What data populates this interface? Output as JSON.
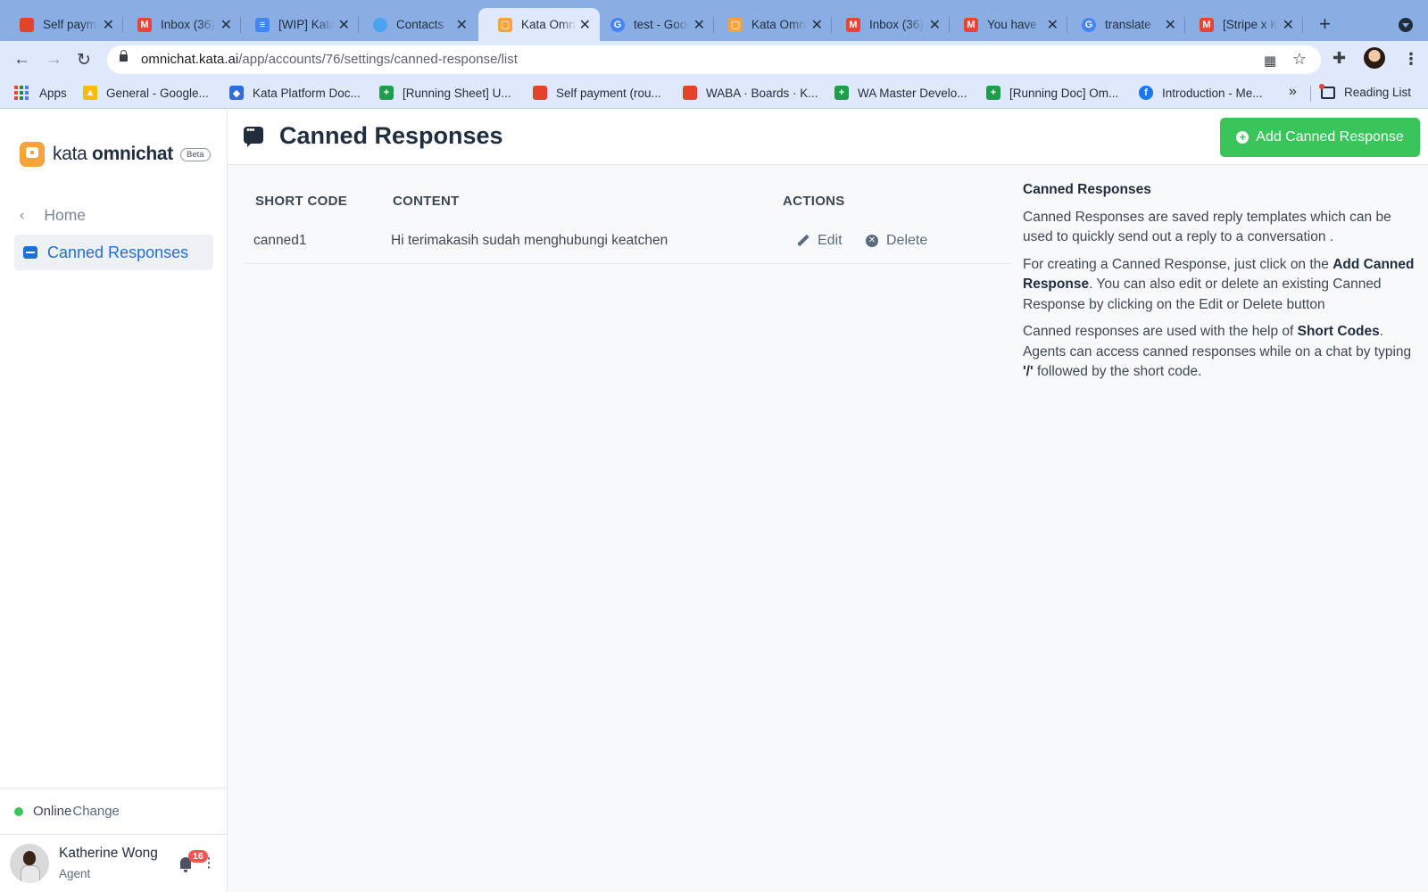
{
  "browser": {
    "tabs": [
      {
        "title": "Self payment",
        "icon": "gitlab-icon",
        "color": "#e24329"
      },
      {
        "title": "Inbox (36)",
        "icon": "gmail-icon",
        "color": "#ea4335"
      },
      {
        "title": "[WIP] Kata",
        "icon": "docs-icon",
        "color": "#4285f4"
      },
      {
        "title": "Contacts",
        "icon": "contacts-icon",
        "color": "#4aa3f0"
      },
      {
        "title": "Kata Omnichat",
        "icon": "kata-icon",
        "color": "#f7a33c"
      },
      {
        "title": "test - Google",
        "icon": "google-icon",
        "color": "#4285f4"
      },
      {
        "title": "Kata Omnichat",
        "icon": "kata-icon",
        "color": "#f7a33c"
      },
      {
        "title": "Inbox (36)",
        "icon": "gmail-icon",
        "color": "#ea4335"
      },
      {
        "title": "You have",
        "icon": "gmail-icon",
        "color": "#ea4335"
      },
      {
        "title": "translate",
        "icon": "google-icon",
        "color": "#4285f4"
      },
      {
        "title": "[Stripe x K",
        "icon": "gmail-icon",
        "color": "#ea4335"
      }
    ],
    "url_host": "omnichat.kata.ai",
    "url_path": "/app/accounts/76/settings/canned-response/list",
    "bookmarks": [
      {
        "label": "Apps"
      },
      {
        "label": "General - Google...",
        "icon": "drive-icon",
        "color": "#fbbc04"
      },
      {
        "label": "Kata Platform Doc...",
        "icon": "kata-doc-icon",
        "color": "#2f6ed8"
      },
      {
        "label": "[Running Sheet] U...",
        "icon": "sheets-icon",
        "color": "#1e9e4b"
      },
      {
        "label": "Self payment (rou...",
        "icon": "gitlab-icon",
        "color": "#e24329"
      },
      {
        "label": "WABA · Boards · K...",
        "icon": "gitlab-icon",
        "color": "#e24329"
      },
      {
        "label": "WA Master Develo...",
        "icon": "sheets-icon",
        "color": "#1e9e4b"
      },
      {
        "label": "[Running Doc] Om...",
        "icon": "sheets-icon",
        "color": "#1e9e4b"
      },
      {
        "label": "Introduction - Me...",
        "icon": "facebook-icon",
        "color": "#1877f2"
      }
    ],
    "more": "»",
    "reading_list": "Reading List"
  },
  "sidebar": {
    "brand_light": "kata",
    "brand_bold": "omnichat",
    "beta": "Beta",
    "home": "Home",
    "active_item": "Canned Responses",
    "status": "Online",
    "change": "Change",
    "user_name": "Katherine Wong",
    "user_role": "Agent",
    "notifications": "16",
    "status_color": "#3ac55b"
  },
  "main": {
    "title": "Canned Responses",
    "add_button": "Add Canned Response",
    "columns": [
      "SHORT CODE",
      "CONTENT",
      "ACTIONS"
    ],
    "rows": [
      {
        "short_code": "canned1",
        "content": "Hi terimakasih sudah menghubungi keatchen",
        "edit": "Edit",
        "delete": "Delete"
      }
    ],
    "help": {
      "heading": "Canned Responses",
      "p1": "Canned Responses are saved reply templates which can be used to quickly send out a reply to a conversation .",
      "p2_a": "For creating a Canned Response, just click on the ",
      "p2_b": "Add Canned Response",
      "p2_c": ". You can also edit or delete an existing Canned Response by clicking on the Edit or Delete button",
      "p3_a": "Canned responses are used with the help of ",
      "p3_b": "Short Codes",
      "p3_c": ". Agents can access canned responses while on a chat by typing ",
      "p3_d": "'/'",
      "p3_e": " followed by the short code."
    }
  },
  "colors": {
    "accent": "#1f6fd6",
    "primary_button": "#3ac55b",
    "brand": "#f7a33c"
  }
}
